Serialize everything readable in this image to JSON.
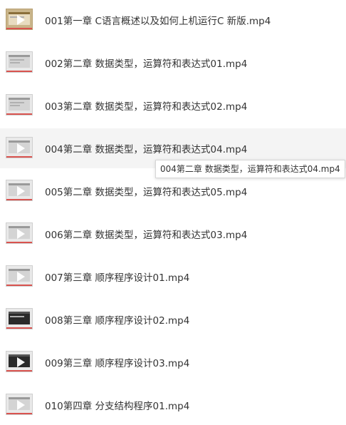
{
  "files": [
    {
      "name": "001第一章 C语言概述以及如何上机运行C 新版.mp4"
    },
    {
      "name": "002第二章 数据类型，运算符和表达式01.mp4"
    },
    {
      "name": "003第二章 数据类型，运算符和表达式02.mp4"
    },
    {
      "name": "004第二章 数据类型，运算符和表达式04.mp4"
    },
    {
      "name": "005第二章 数据类型，运算符和表达式05.mp4"
    },
    {
      "name": "006第二章 数据类型，运算符和表达式03.mp4"
    },
    {
      "name": "007第三章 顺序程序设计01.mp4"
    },
    {
      "name": "008第三章 顺序程序设计02.mp4"
    },
    {
      "name": "009第三章 顺序程序设计03.mp4"
    },
    {
      "name": "010第四章 分支结构程序01.mp4"
    }
  ],
  "tooltip": {
    "text": "004第二章 数据类型，运算符和表达式04.mp4"
  },
  "colors": {
    "hover_row": "#f4f4f4",
    "text": "#333333",
    "thumb_accent": "#d9534f"
  },
  "icons": {
    "thumbnail": "video-thumbnail-icon",
    "play": "play-icon"
  }
}
